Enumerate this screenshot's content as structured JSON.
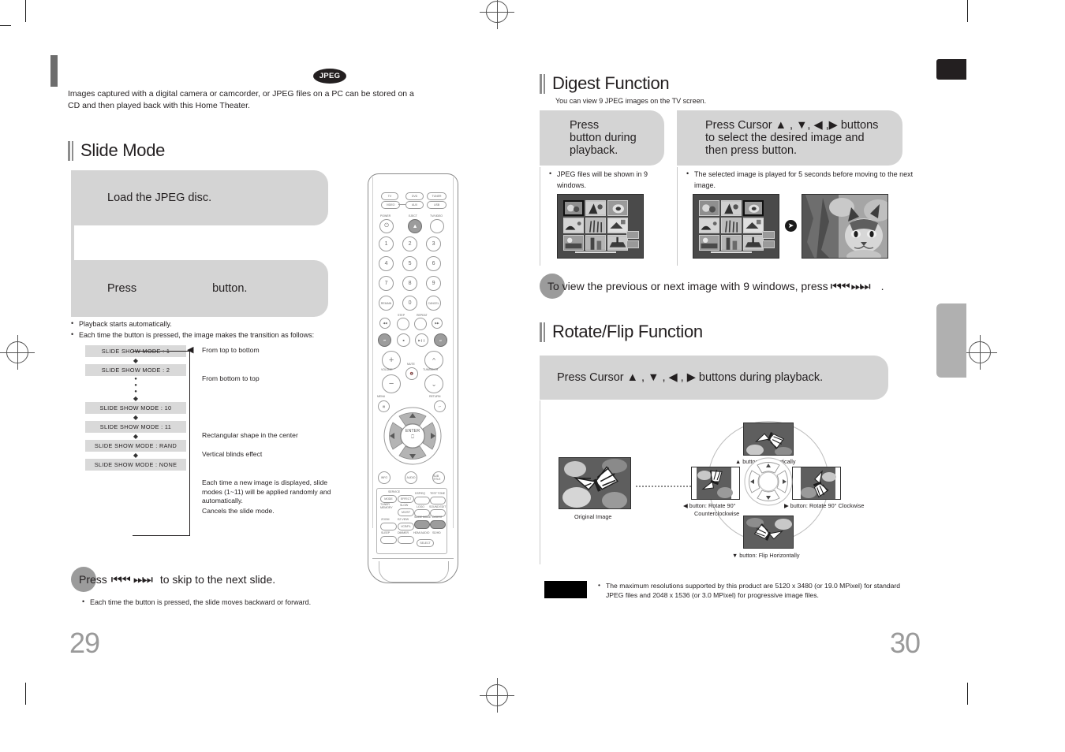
{
  "page": {
    "left_number": "29",
    "right_number": "30"
  },
  "left": {
    "badge": "JPEG",
    "intro": "Images captured with a digital camera or camcorder, or JPEG files on a PC can be stored on a CD and then played back with this Home Theater.",
    "heading": "Slide Mode",
    "step1": "Load the JPEG disc.",
    "step2_pre": "Press",
    "step2_post": "button.",
    "bullets": [
      "Playback starts automatically.",
      "Each time the button is pressed, the image makes the transition as follows:"
    ],
    "flow": [
      {
        "chip": "SLIDE SHOW MODE : 1",
        "desc": "From top to bottom"
      },
      {
        "chip": "SLIDE SHOW MODE : 2",
        "desc": "From bottom to top"
      },
      {
        "chip": "SLIDE SHOW MODE : 10",
        "desc": "Rectangular shape in the center"
      },
      {
        "chip": "SLIDE SHOW MODE : 11",
        "desc": "Vertical blinds effect"
      },
      {
        "chip": "SLIDE SHOW MODE : RAND",
        "desc": "Each time a new image is displayed, slide modes (1~11) will be applied randomly and automatically."
      },
      {
        "chip": "SLIDE SHOW MODE : NONE",
        "desc": "Cancels the slide mode."
      }
    ],
    "pill_pre": "Press",
    "pill_icon_prev": "⏮⏮",
    "pill_icon_next": "⏭⏭",
    "pill_post": "to skip to the next slide.",
    "pill_bullet": "Each time the button is pressed, the slide moves backward or forward."
  },
  "right": {
    "digest": {
      "heading": "Digest Function",
      "subtitle": "You can view 9 JPEG images on the TV screen.",
      "step1_lines": [
        "Press",
        "button during",
        "playback."
      ],
      "step1_bullet": "JPEG files will be shown in 9 windows.",
      "step2_lines": [
        "Press Cursor  ▲ ,  ▼, ◀ ,▶  buttons",
        "to select the desired image and",
        "then press              button."
      ],
      "step2_bullet": "The selected image is played for 5 seconds before moving to the next image."
    },
    "pill": {
      "text": "To view the previous or next image with 9 windows, press",
      "icon_prev": "⏮⏮",
      "icon_next": "⏭⏭",
      "tail": "."
    },
    "rotate": {
      "heading": "Rotate/Flip Function",
      "step": "Press Cursor  ▲ , ▼ , ◀ , ▶   buttons during playback.",
      "original_caption": "Original Image",
      "captions": {
        "up": "▲ button: Flip Vertically",
        "down": "▼ button: Flip Horizontally",
        "left_l1": "◀ button: Rotate 90°",
        "left_l2": "Counterclockwise",
        "right": "▶ button: Rotate 90° Clockwise"
      }
    },
    "note": "The maximum resolutions supported by this product are 5120 x 3480 (or 19.0 MPixel) for standard JPEG files and 2048 x 1536 (or 3.0 MPixel) for progressive image files."
  },
  "remote": {
    "source_row": [
      "TV",
      "DVD",
      "TUNER",
      "VIDEO",
      "AUX",
      "USB"
    ],
    "labels": {
      "power": "POWER",
      "eject": "EJECT",
      "tvvideo": "TV/VIDEO",
      "step": "STEP",
      "repeat": "REPEAT",
      "volume": "VOLUME",
      "mute": "MUTE",
      "tuning": "TUNING/CH",
      "menu": "MENU",
      "return": "RETURN",
      "enter": "ENTER",
      "remain": "REMAIN",
      "cancel": "CANCEL",
      "info": "INFO",
      "audio": "AUDIO",
      "subtitle": "SUB TITLE"
    },
    "numbers": [
      "1",
      "2",
      "3",
      "4",
      "5",
      "6",
      "7",
      "8",
      "9",
      "0"
    ],
    "panel": {
      "service": "SERVICE",
      "rows": [
        [
          "MODE",
          "EFFECT",
          "DSP/EQ",
          "TEST TONE"
        ],
        [
          "TUNER MEMORY",
          "SLOW",
          "LOGO",
          "SOUND EDIT"
        ],
        [
          "",
          "MO/ST",
          "",
          ""
        ],
        [
          "ZOOM",
          "EZ VIEW",
          "SLIDE MODE",
          "DIGEST"
        ],
        [
          "",
          "VCR/P.L",
          "",
          ""
        ],
        [
          "SLEEP",
          "DIMMER",
          "HDMI AUDIO",
          "SD/HD"
        ],
        [
          "",
          "",
          "SELECT",
          ""
        ]
      ],
      "highlighted": [
        "SLIDE MODE",
        "DIGEST"
      ]
    }
  },
  "colors": {
    "step_box": "#d4d4d4",
    "chip": "#d9d9d9",
    "pill_dot": "#9b9b9b",
    "tab_black": "#231f20",
    "tab_gray": "#b0b0b0",
    "page_number": "#9a9a9a"
  }
}
